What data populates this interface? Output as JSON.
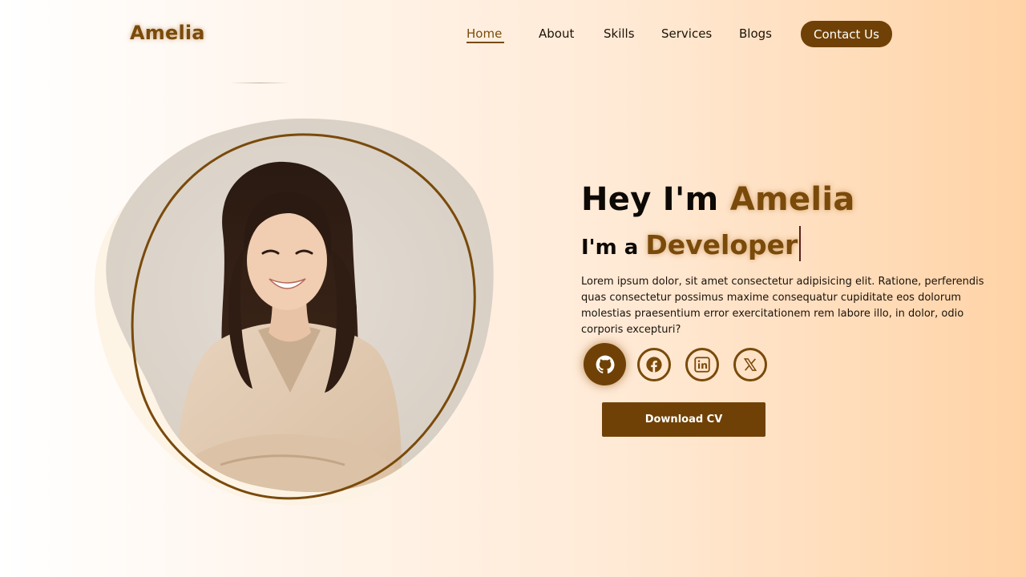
{
  "header": {
    "logo": "Amelia",
    "nav": [
      {
        "label": "Home",
        "active": true
      },
      {
        "label": "About",
        "active": false
      },
      {
        "label": "Skills",
        "active": false
      },
      {
        "label": "Services",
        "active": false
      },
      {
        "label": "Blogs",
        "active": false
      }
    ],
    "contact_label": "Contact Us"
  },
  "hero": {
    "greeting": "Hey I'm",
    "name": "Amelia",
    "role_prefix": "I'm a",
    "role": "Developer",
    "description": "Lorem ipsum dolor, sit amet consectetur adipisicing elit. Ratione, perferendis quas consectetur possimus maxime consequatur cupiditate eos dolorum molestias praesentium error exercitationem rem labore illo, in dolor, odio corporis excepturi?",
    "socials": [
      {
        "icon": "github-icon",
        "active": true
      },
      {
        "icon": "facebook-icon",
        "active": false
      },
      {
        "icon": "linkedin-icon",
        "active": false
      },
      {
        "icon": "x-icon",
        "active": false
      }
    ],
    "download_label": "Download CV"
  },
  "colors": {
    "accent": "#704106",
    "accent_text": "#7a4a0b",
    "background_left": "#ffffff",
    "background_right": "#ffd3a6"
  }
}
